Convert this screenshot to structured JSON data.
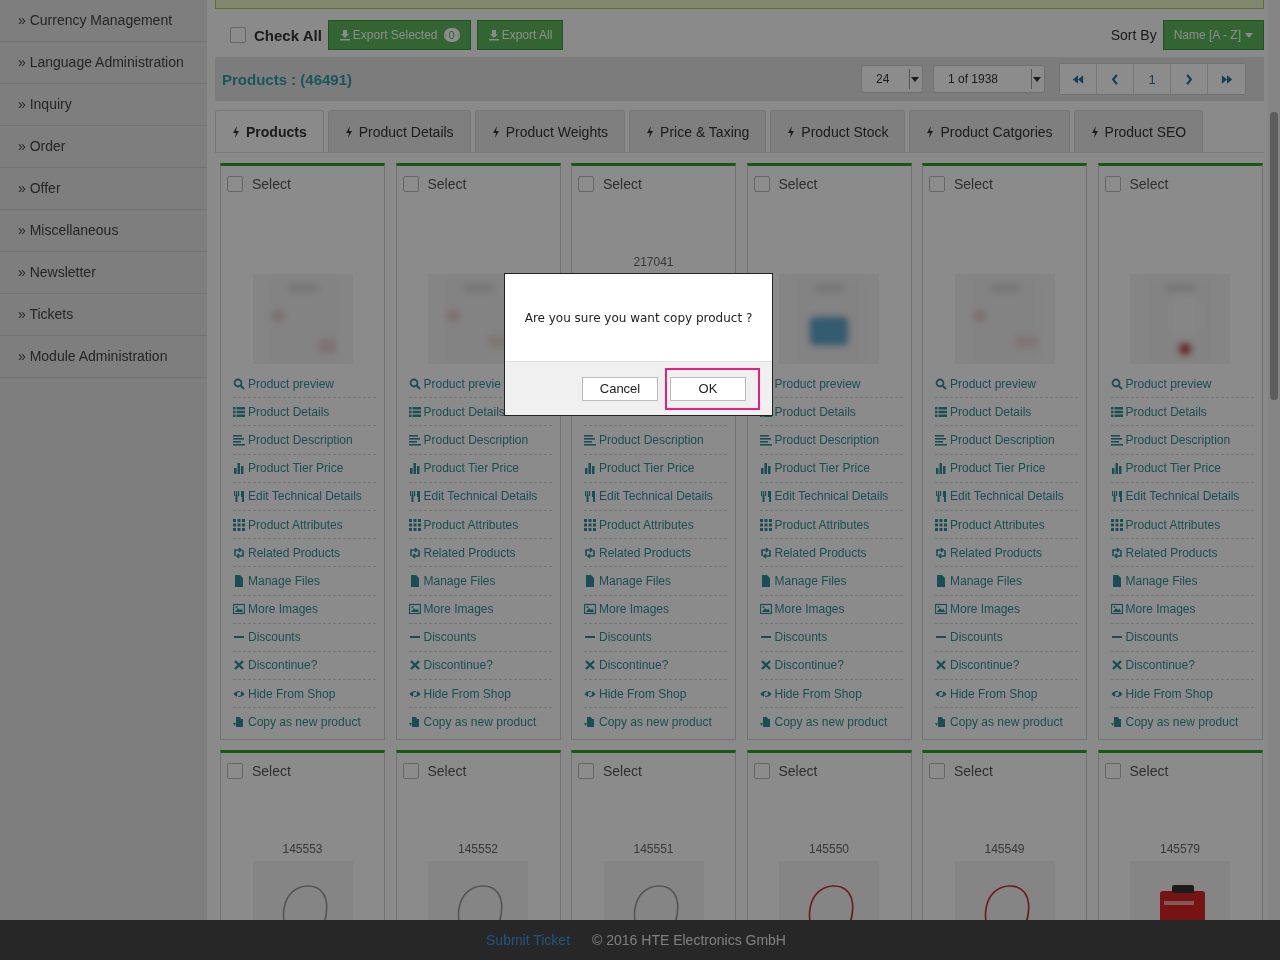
{
  "sidebar": {
    "items": [
      {
        "label": "» Currency Management"
      },
      {
        "label": "» Language Administration"
      },
      {
        "label": "» Inquiry"
      },
      {
        "label": "» Order"
      },
      {
        "label": "» Offer"
      },
      {
        "label": "» Miscellaneous"
      },
      {
        "label": "» Newsletter"
      },
      {
        "label": "» Tickets"
      },
      {
        "label": "» Module Administration"
      }
    ]
  },
  "toolbar": {
    "check_all": {
      "label": "Check All",
      "checked": false
    },
    "export_selected": {
      "label": "Export Selected",
      "count": "0"
    },
    "export_all": {
      "label": "Export All"
    },
    "sort_label": "Sort By",
    "sort_value": "Name [A - Z]"
  },
  "summary": {
    "title": "Products : (46491)",
    "per_page": "24",
    "page": "1 of 1938",
    "pagination": [
      {
        "kind": "first"
      },
      {
        "kind": "prev"
      },
      {
        "kind": "page",
        "label": "1"
      },
      {
        "kind": "next"
      },
      {
        "kind": "last"
      }
    ]
  },
  "tabs": [
    {
      "label": "Products",
      "selected": true
    },
    {
      "label": "Product Details",
      "selected": false
    },
    {
      "label": "Product Weights",
      "selected": false
    },
    {
      "label": "Price & Taxing",
      "selected": false
    },
    {
      "label": "Product Stock",
      "selected": false
    },
    {
      "label": "Product Catgories",
      "selected": false
    },
    {
      "label": "Product SEO",
      "selected": false
    }
  ],
  "cards": [
    {
      "select_label": "Select",
      "checked": false,
      "links": [
        {
          "kind": "preview",
          "label": "Product preview"
        },
        {
          "kind": "details",
          "label": "Product Details"
        },
        {
          "kind": "description",
          "label": "Product Description"
        },
        {
          "kind": "tier",
          "label": "Product Tier Price"
        },
        {
          "kind": "technical",
          "label": "Edit Technical Details"
        },
        {
          "kind": "attributes",
          "label": "Product Attributes"
        },
        {
          "kind": "related",
          "label": "Related Products"
        },
        {
          "kind": "files",
          "label": "Manage Files"
        },
        {
          "kind": "images",
          "label": "More Images"
        },
        {
          "kind": "discounts",
          "label": "Discounts"
        },
        {
          "kind": "discontinue",
          "label": "Discontinue?"
        },
        {
          "kind": "hide",
          "label": "Hide From Shop"
        },
        {
          "kind": "copy",
          "label": "Copy as new product"
        }
      ]
    },
    {
      "select_label": "Select",
      "checked": false,
      "links": [
        {
          "kind": "preview",
          "label": "Product previe"
        },
        {
          "kind": "details",
          "label": "Product Details"
        },
        {
          "kind": "description",
          "label": "Product Description"
        },
        {
          "kind": "tier",
          "label": "Product Tier Price"
        },
        {
          "kind": "technical",
          "label": "Edit Technical Details"
        },
        {
          "kind": "attributes",
          "label": "Product Attributes"
        },
        {
          "kind": "related",
          "label": "Related Products"
        },
        {
          "kind": "files",
          "label": "Manage Files"
        },
        {
          "kind": "images",
          "label": "More Images"
        },
        {
          "kind": "discounts",
          "label": "Discounts"
        },
        {
          "kind": "discontinue",
          "label": "Discontinue?"
        },
        {
          "kind": "hide",
          "label": "Hide From Shop"
        },
        {
          "kind": "copy",
          "label": "Copy as new product"
        }
      ]
    },
    {
      "select_label": "Select",
      "checked": false,
      "code": "217041",
      "links": [
        {
          "kind": "description",
          "label": "Product Description"
        },
        {
          "kind": "tier",
          "label": "Product Tier Price"
        },
        {
          "kind": "technical",
          "label": "Edit Technical Details"
        },
        {
          "kind": "attributes",
          "label": "Product Attributes"
        },
        {
          "kind": "related",
          "label": "Related Products"
        },
        {
          "kind": "files",
          "label": "Manage Files"
        },
        {
          "kind": "images",
          "label": "More Images"
        },
        {
          "kind": "discounts",
          "label": "Discounts"
        },
        {
          "kind": "discontinue",
          "label": "Discontinue?"
        },
        {
          "kind": "hide",
          "label": "Hide From Shop"
        },
        {
          "kind": "copy",
          "label": "Copy as new product"
        }
      ]
    },
    {
      "select_label": "Select",
      "checked": false,
      "links": [
        {
          "label": "Product preview"
        },
        {
          "kind": "details",
          "label": "Product Details"
        },
        {
          "kind": "description",
          "label": "Product Description"
        },
        {
          "kind": "tier",
          "label": "Product Tier Price"
        },
        {
          "kind": "technical",
          "label": "Edit Technical Details"
        },
        {
          "kind": "attributes",
          "label": "Product Attributes"
        },
        {
          "kind": "related",
          "label": "Related Products"
        },
        {
          "kind": "files",
          "label": "Manage Files"
        },
        {
          "kind": "images",
          "label": "More Images"
        },
        {
          "kind": "discounts",
          "label": "Discounts"
        },
        {
          "kind": "discontinue",
          "label": "Discontinue?"
        },
        {
          "kind": "hide",
          "label": "Hide From Shop"
        },
        {
          "kind": "copy",
          "label": "Copy as new product"
        }
      ]
    },
    {
      "select_label": "Select",
      "checked": false,
      "links": [
        {
          "kind": "preview",
          "label": "Product preview"
        },
        {
          "kind": "details",
          "label": "Product Details"
        },
        {
          "kind": "description",
          "label": "Product Description"
        },
        {
          "kind": "tier",
          "label": "Product Tier Price"
        },
        {
          "kind": "technical",
          "label": "Edit Technical Details"
        },
        {
          "kind": "attributes",
          "label": "Product Attributes"
        },
        {
          "kind": "related",
          "label": "Related Products"
        },
        {
          "kind": "files",
          "label": "Manage Files"
        },
        {
          "kind": "images",
          "label": "More Images"
        },
        {
          "kind": "discounts",
          "label": "Discounts"
        },
        {
          "kind": "discontinue",
          "label": "Discontinue?"
        },
        {
          "kind": "hide",
          "label": "Hide From Shop"
        },
        {
          "kind": "copy",
          "label": "Copy as new product"
        }
      ]
    },
    {
      "select_label": "Select",
      "checked": false,
      "links": [
        {
          "kind": "preview",
          "label": "Product preview"
        },
        {
          "kind": "details",
          "label": "Product Details"
        },
        {
          "kind": "description",
          "label": "Product Description"
        },
        {
          "kind": "tier",
          "label": "Product Tier Price"
        },
        {
          "kind": "technical",
          "label": "Edit Technical Details"
        },
        {
          "kind": "attributes",
          "label": "Product Attributes"
        },
        {
          "kind": "related",
          "label": "Related Products"
        },
        {
          "kind": "files",
          "label": "Manage Files"
        },
        {
          "kind": "images",
          "label": "More Images"
        },
        {
          "kind": "discounts",
          "label": "Discounts"
        },
        {
          "kind": "discontinue",
          "label": "Discontinue?"
        },
        {
          "kind": "hide",
          "label": "Hide From Shop"
        },
        {
          "kind": "copy",
          "label": "Copy as new product"
        }
      ]
    },
    {
      "select_label": "Select",
      "checked": false,
      "code": "145553"
    },
    {
      "select_label": "Select",
      "checked": false,
      "code": "145552"
    },
    {
      "select_label": "Select",
      "checked": false,
      "code": "145551"
    },
    {
      "select_label": "Select",
      "checked": false,
      "code": "145550"
    },
    {
      "select_label": "Select",
      "checked": false,
      "code": "145549"
    },
    {
      "select_label": "Select",
      "checked": false,
      "code": "145579"
    }
  ],
  "modal": {
    "message": "Are you sure you want copy product ?",
    "buttons": [
      {
        "label": "Cancel",
        "focused": false
      },
      {
        "label": "OK",
        "focused": true
      }
    ]
  },
  "footer": {
    "link": "Submit Ticket",
    "copyright": "© 2016 HTE Electronics GmbH"
  }
}
